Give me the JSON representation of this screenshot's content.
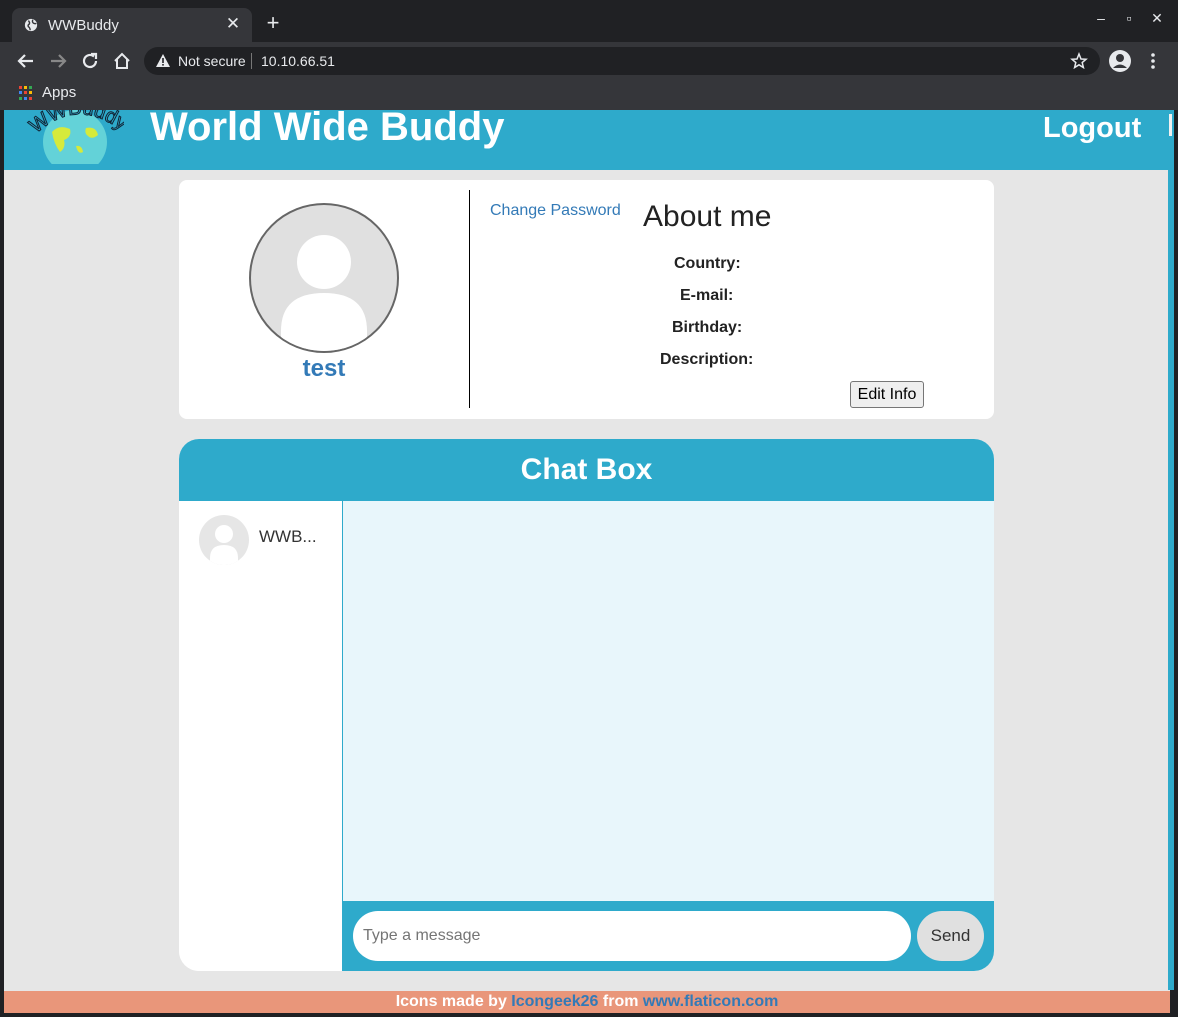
{
  "browser": {
    "tab_title": "WWBuddy",
    "security_label": "Not secure",
    "url": "10.10.66.51",
    "bookmarks": [
      {
        "label": "Apps"
      }
    ]
  },
  "site": {
    "logo_text": "WWBuddy",
    "title": "World Wide Buddy",
    "logout_label": "Logout"
  },
  "profile": {
    "username": "test",
    "change_password_label": "Change Password",
    "about_title": "About me",
    "fields": [
      {
        "label": "Country:"
      },
      {
        "label": "E-mail:"
      },
      {
        "label": "Birthday:"
      },
      {
        "label": "Description:"
      }
    ],
    "edit_button_label": "Edit Info"
  },
  "chat": {
    "title": "Chat Box",
    "contacts": [
      {
        "name": "WWB..."
      }
    ],
    "input_placeholder": "Type a message",
    "send_label": "Send"
  },
  "footer": {
    "prefix": "Icons made by ",
    "author": "Icongeek26",
    "middle": " from ",
    "site": "www.flaticon.com"
  },
  "colors": {
    "brand": "#2eaacb",
    "link": "#337ab7",
    "footer": "#e9967a",
    "chat_background": "#e8f6fb",
    "page_background": "#e6e6e6"
  }
}
